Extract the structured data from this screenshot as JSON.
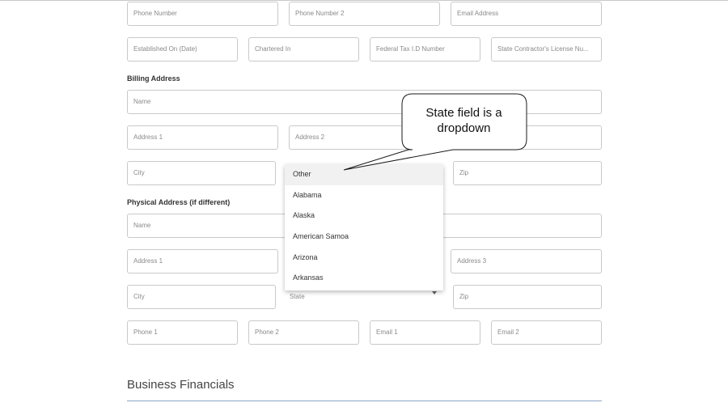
{
  "contact_row": {
    "phone_number_placeholder": "Phone Number",
    "phone_number_2_placeholder": "Phone Number 2",
    "email_address_placeholder": "Email Address"
  },
  "company_row": {
    "established_on_placeholder": "Established On (Date)",
    "chartered_in_placeholder": "Chartered In",
    "federal_tax_id_placeholder": "Federal Tax I.D Number",
    "state_license_placeholder": "State Contractor's License Nu..."
  },
  "billing_address": {
    "heading": "Billing Address",
    "name_placeholder": "Name",
    "address1_placeholder": "Address 1",
    "address2_placeholder": "Address 2",
    "city_placeholder": "City",
    "zip_placeholder": "Zip"
  },
  "state_dropdown": {
    "options": [
      "Other",
      "Alabama",
      "Alaska",
      "American Samoa",
      "Arizona",
      "Arkansas"
    ],
    "highlighted": "Other"
  },
  "physical_address": {
    "heading": "Physical Address (if different)",
    "name_placeholder": "Name",
    "address1_placeholder": "Address 1",
    "address3_placeholder": "Address 3",
    "city_placeholder": "City",
    "state_placeholder": "State",
    "zip_placeholder": "Zip",
    "phone1_placeholder": "Phone 1",
    "phone2_placeholder": "Phone 2",
    "email1_placeholder": "Email 1",
    "email2_placeholder": "Email 2"
  },
  "business_financials": {
    "heading": "Business Financials"
  },
  "annotation": {
    "text": "State field is a\ndropdown"
  },
  "colors": {
    "field_border": "#c9c9c9",
    "placeholder_text": "#8a8a8a",
    "section_divider": "#8aa8c8",
    "highlight_row": "#f1f1f1"
  }
}
